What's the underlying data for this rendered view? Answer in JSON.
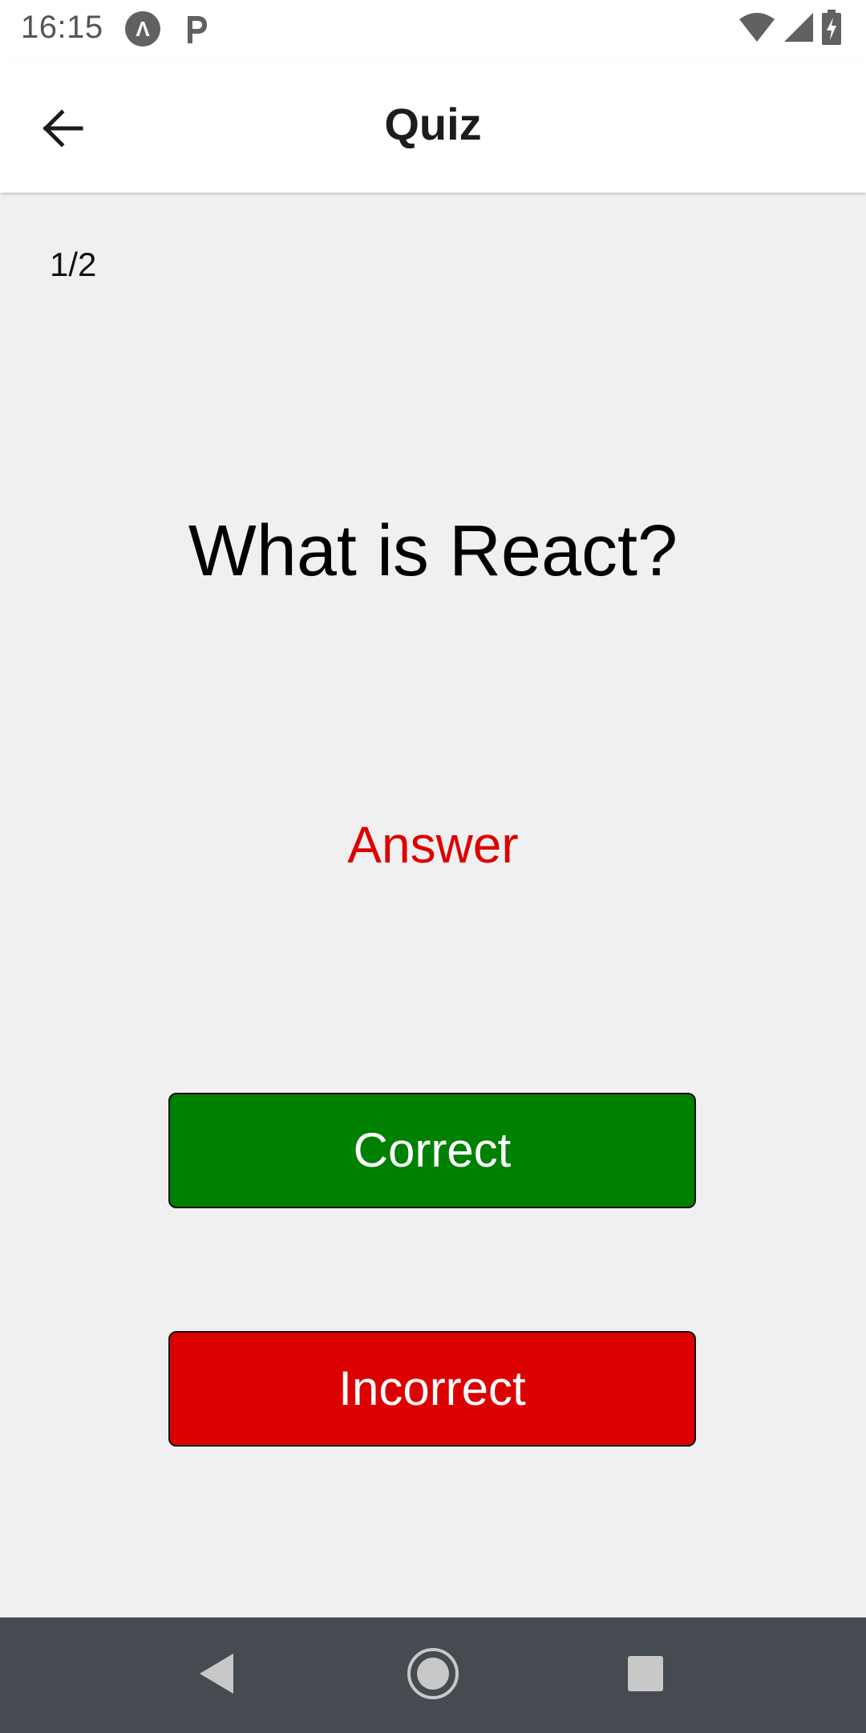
{
  "status_bar": {
    "time": "16:15",
    "icons": [
      "app-a-icon",
      "parking-icon",
      "wifi-icon",
      "cellular-icon",
      "battery-charging-icon"
    ]
  },
  "app_bar": {
    "title": "Quiz",
    "back_icon": "arrow-back-icon"
  },
  "quiz": {
    "progress": "1/2",
    "question": "What is React?",
    "answer_label": "Answer",
    "correct_label": "Correct",
    "incorrect_label": "Incorrect"
  },
  "nav_bar": {
    "icons": [
      "nav-back-icon",
      "nav-home-icon",
      "nav-recents-icon"
    ]
  },
  "colors": {
    "background": "#f0f0f0",
    "correct": "#008000",
    "incorrect": "#dd0000",
    "answer_text": "#dd0000",
    "nav_bar": "#454b50"
  }
}
